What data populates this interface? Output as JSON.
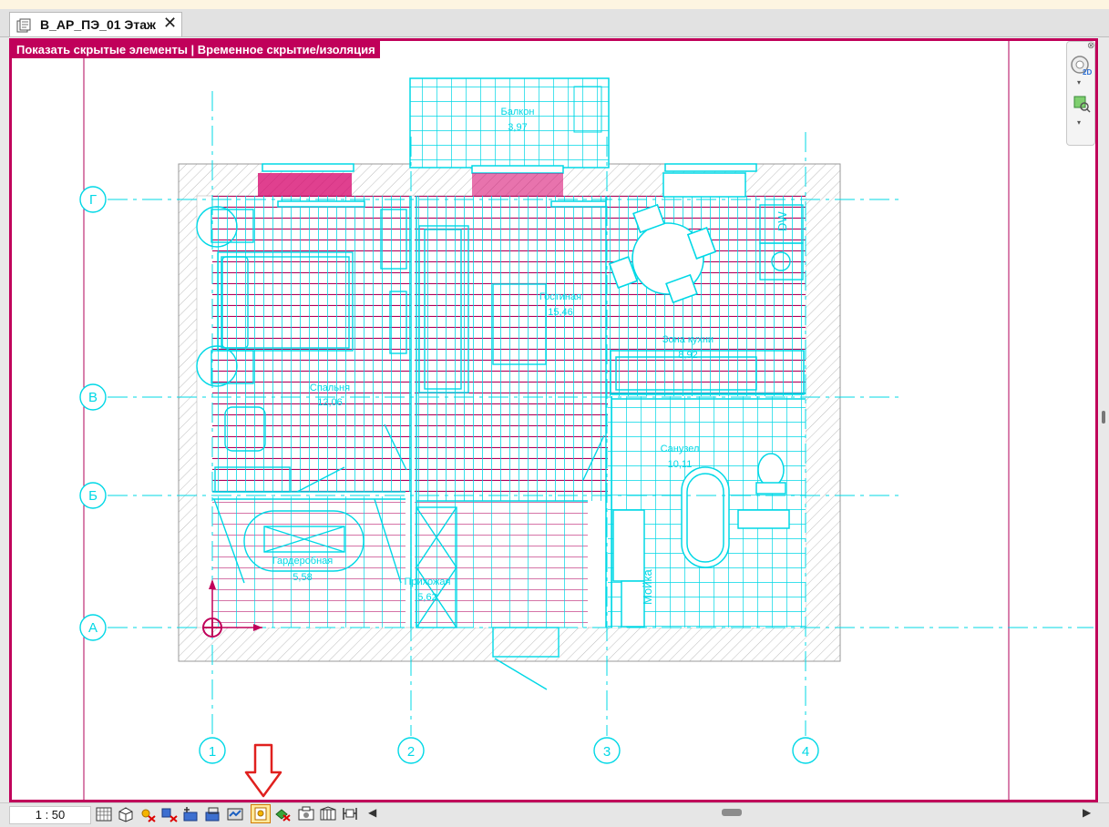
{
  "tab": {
    "title": "В_АР_ПЭ_01 Этаж"
  },
  "banner": {
    "text": "Показать скрытые элементы | Временное скрытие/изоляция"
  },
  "rooms": {
    "balcony": {
      "name": "Балкон",
      "area": "3,97"
    },
    "living": {
      "name": "Гостиная",
      "area": "15,46"
    },
    "kitchen": {
      "name": "Зона кухни",
      "area": "8,92"
    },
    "bedroom": {
      "name": "Спальня",
      "area": "12,06"
    },
    "bathroom": {
      "name": "Санузел",
      "area": "10,11"
    },
    "wardrobe": {
      "name": "Гардеробная",
      "area": "5,58"
    },
    "hall": {
      "name": "Прихожая",
      "area": "5,62"
    },
    "sink_label": "Мойка",
    "dw_label": "DW"
  },
  "grid": {
    "rows": [
      "Г",
      "В",
      "Б",
      "А"
    ],
    "cols": [
      "1",
      "2",
      "3",
      "4"
    ]
  },
  "navbar": {
    "mode": "2D"
  },
  "status": {
    "scale": "1 : 50",
    "tools": [
      "detail-level-icon",
      "visual-style-icon",
      "sun-path-icon",
      "shadows-icon",
      "crop-view-icon",
      "show-crop-icon",
      "unlock-3d-icon",
      "temporary-hide-icon",
      "reveal-hidden-icon",
      "temporary-view-properties-icon",
      "hide-analytical-icon",
      "highlight-displacement-icon",
      "reveal-constraints-icon"
    ]
  },
  "colors": {
    "accent": "#c0005a",
    "cyan": "#00d8e6",
    "magenta": "#b0005a",
    "arrow": "#e0201e"
  }
}
